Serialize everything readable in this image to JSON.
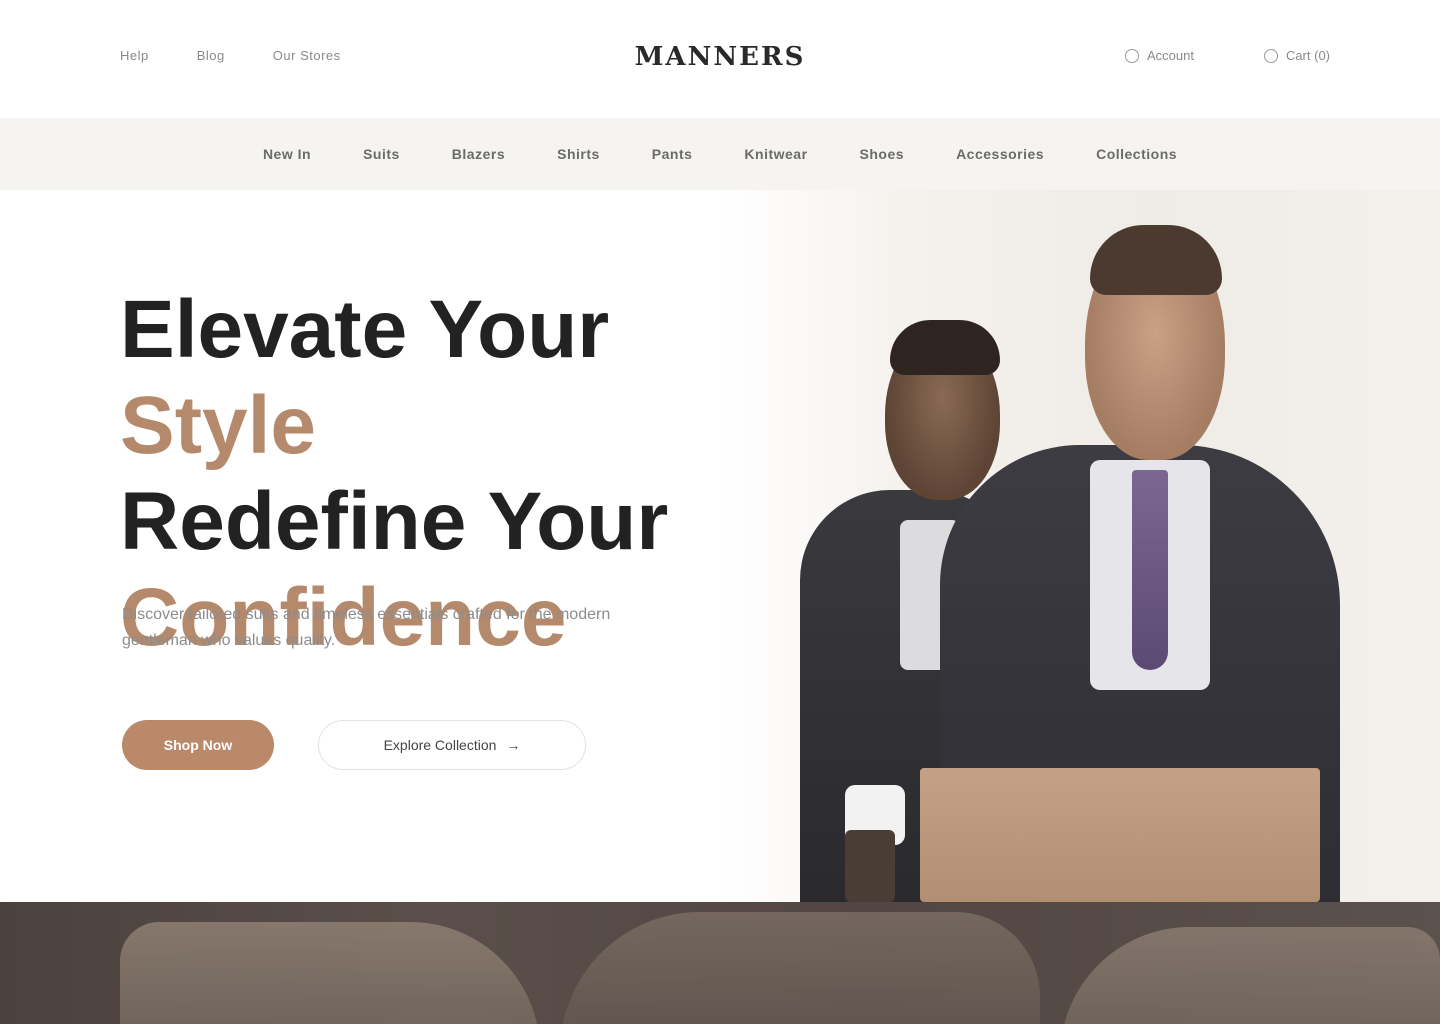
{
  "header": {
    "left_links": [
      "Help",
      "Blog",
      "Our Stores"
    ],
    "logo": "MANNERS",
    "right_links": [
      "Account",
      "Cart (0)"
    ]
  },
  "category_nav": [
    "New In",
    "Suits",
    "Blazers",
    "Shirts",
    "Pants",
    "Knitwear",
    "Shoes",
    "Accessories",
    "Collections"
  ],
  "hero": {
    "headline_part1": "Elevate Your",
    "headline_accent1": "Style",
    "headline_part2": "Redefine Your",
    "headline_accent2": "Confidence",
    "subtext": "Discover tailored suits and timeless essentials crafted for the modern gentleman who values quality.",
    "primary_button": "Shop Now",
    "secondary_button": "Explore Collection"
  },
  "colors": {
    "accent": "#b58a6c",
    "button": "#b9896a",
    "band": "#4b413d"
  }
}
